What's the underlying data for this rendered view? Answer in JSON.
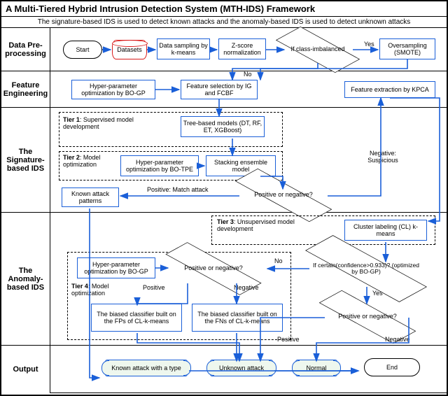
{
  "title": "A Multi-Tiered Hybrid Intrusion Detection System (MTH-IDS) Framework",
  "subtitle": "The signature-based IDS is used to detect known attacks and the anomaly-based IDS is used to detect unknown attacks",
  "sections": {
    "preproc": "Data Pre-processing",
    "feat": "Feature Engineering",
    "sig": "The Signature-based IDS",
    "anom": "The Anomaly-based IDS",
    "out": "Output"
  },
  "nodes": {
    "start": "Start",
    "datasets": "Datasets",
    "sampling": "Data sampling by k-means",
    "zscore": "Z-score normalization",
    "imbalanced": "If class-imbalanced",
    "smote": "Oversampling (SMOTE)",
    "hpo_gp1": "Hyper-parameter optimization by BO-GP",
    "fsel": "Feature selection by IG and FCBF",
    "kpca": "Feature extraction by KPCA",
    "tier1": "Tier 1",
    "tier1_txt": ": Supervised model development",
    "tree": "Tree-based models (DT, RF, ET, XGBoost)",
    "tier2": "Tier 2",
    "tier2_txt": ": Model optimization",
    "hpo_tpe": "Hyper-parameter optimization by BO-TPE",
    "stack": "Stacking ensemble model",
    "posneg1": "Positive or negative?",
    "known_patterns": "Known attack patterns",
    "match": "Positive: Match attack",
    "neg_susp": "Negative: Suspicious",
    "tier3": "Tier 3",
    "tier3_txt": ": Unsupervised model development",
    "cl": "Cluster labeling (CL) k-means",
    "hpo_gp2": "Hyper-parameter optimization by BO-GP",
    "tier4": "Tier 4",
    "tier4_txt": ": Model optimization",
    "posneg2": "Positive or negative?",
    "conf": "If certain(confidence>0.933)? (optimized by BO-GP)",
    "fp": "The biased classifier built on the FPs of CL-k-means",
    "fn": "The biased classifier built on the FNs of CL-k-means",
    "posneg3": "Positive or negative?",
    "known_type": "Known attack with a type",
    "unknown": "Unknown attack",
    "normal": "Normal",
    "end": "End"
  },
  "labels": {
    "yes": "Yes",
    "no": "No",
    "positive": "Positive",
    "negative": "Negative"
  }
}
